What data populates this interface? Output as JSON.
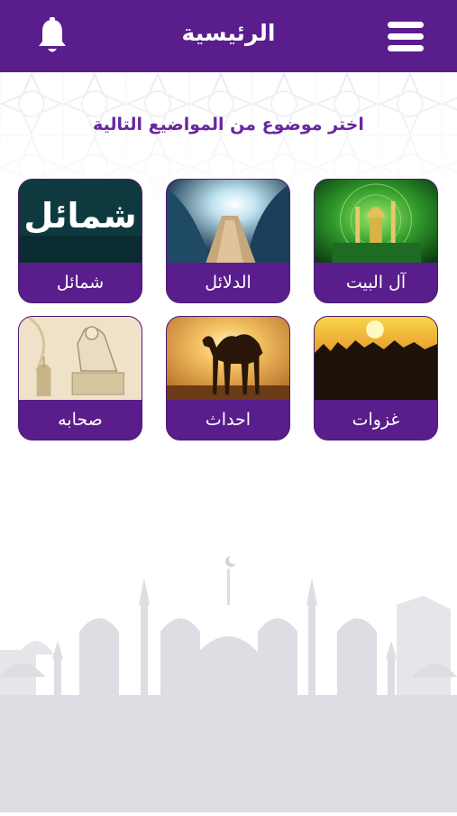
{
  "header": {
    "title": "الرئيسية",
    "menu_icon": "hamburger-menu-icon",
    "notification_icon": "bell-icon"
  },
  "subtitle": "اختر موضوع من المواضيع التالية",
  "tiles": [
    {
      "label": "آل البيت",
      "image": "green-shrine-calligraphy"
    },
    {
      "label": "الدلائل",
      "image": "parted-sea-path"
    },
    {
      "label": "شمائل",
      "image": "shamail-title-card",
      "image_text": "شمائل"
    },
    {
      "label": "غزوات",
      "image": "army-silhouettes-sunset"
    },
    {
      "label": "احداث",
      "image": "camel-at-sunset"
    },
    {
      "label": "صحابه",
      "image": "sketch-reading-figure"
    }
  ],
  "colors": {
    "primary": "#5a1d8c",
    "subtitle": "#6a26a0",
    "skyline": "#dedde3"
  }
}
